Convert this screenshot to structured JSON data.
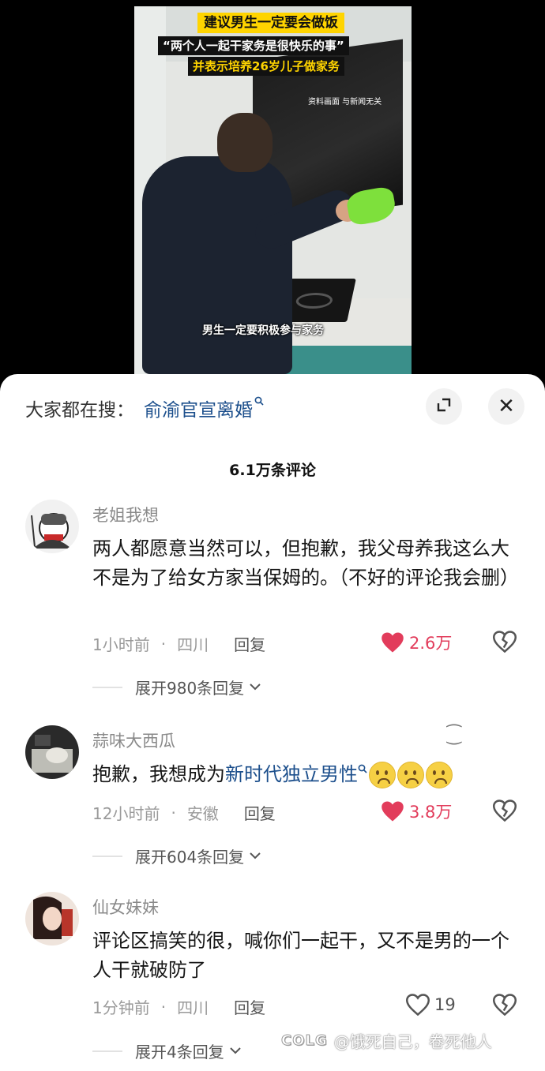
{
  "video": {
    "caption_1": "建议男生一定要会做饭",
    "caption_2": "“两个人一起干家务是很快乐的事”",
    "caption_3": "并表示培养26岁儿子做家务",
    "disclaimer": "资料画面 与新闻无关",
    "subtitle": "男生一定要积极参与家务"
  },
  "search": {
    "prefix": "大家都在搜：",
    "term": "俞渝官宣离婚",
    "icon": "search-icon"
  },
  "controls": {
    "expand_icon": "expand-icon",
    "close_icon": "close-icon",
    "close_glyph": "✕"
  },
  "comment_count": "6.1万条评论",
  "comments": [
    {
      "username": "老姐我想",
      "text": "两人都愿意当然可以，但抱歉，我父母养我这么大不是为了给女方家当保姆的。（不好的评论我会删）",
      "time": "1小时前",
      "location": "四川",
      "reply_label": "回复",
      "likes": "2.6万",
      "liked": true,
      "expand": "展开980条回复"
    },
    {
      "username": "蒜味大西瓜",
      "text_prefix": "抱歉，我想成为",
      "text_link": "新时代独立男性",
      "emoji_icon": "crying-face-emoji",
      "time": "12小时前",
      "location": "安徽",
      "reply_label": "回复",
      "likes": "3.8万",
      "liked": true,
      "expand": "展开604条回复"
    },
    {
      "username": "仙女妹妹",
      "text": "评论区搞笑的很，喊你们一起干，又不是男的一个人干就破防了",
      "time": "1分钟前",
      "location": "四川",
      "reply_label": "回复",
      "likes": "19",
      "liked": false,
      "expand": "展开4条回复"
    }
  ],
  "watermark": {
    "logo": "COLG",
    "text": "@饿死自己，卷死他人"
  },
  "colors": {
    "link": "#1c4f8c",
    "like_red": "#e23c5b",
    "caption_yellow": "#ffd400"
  }
}
